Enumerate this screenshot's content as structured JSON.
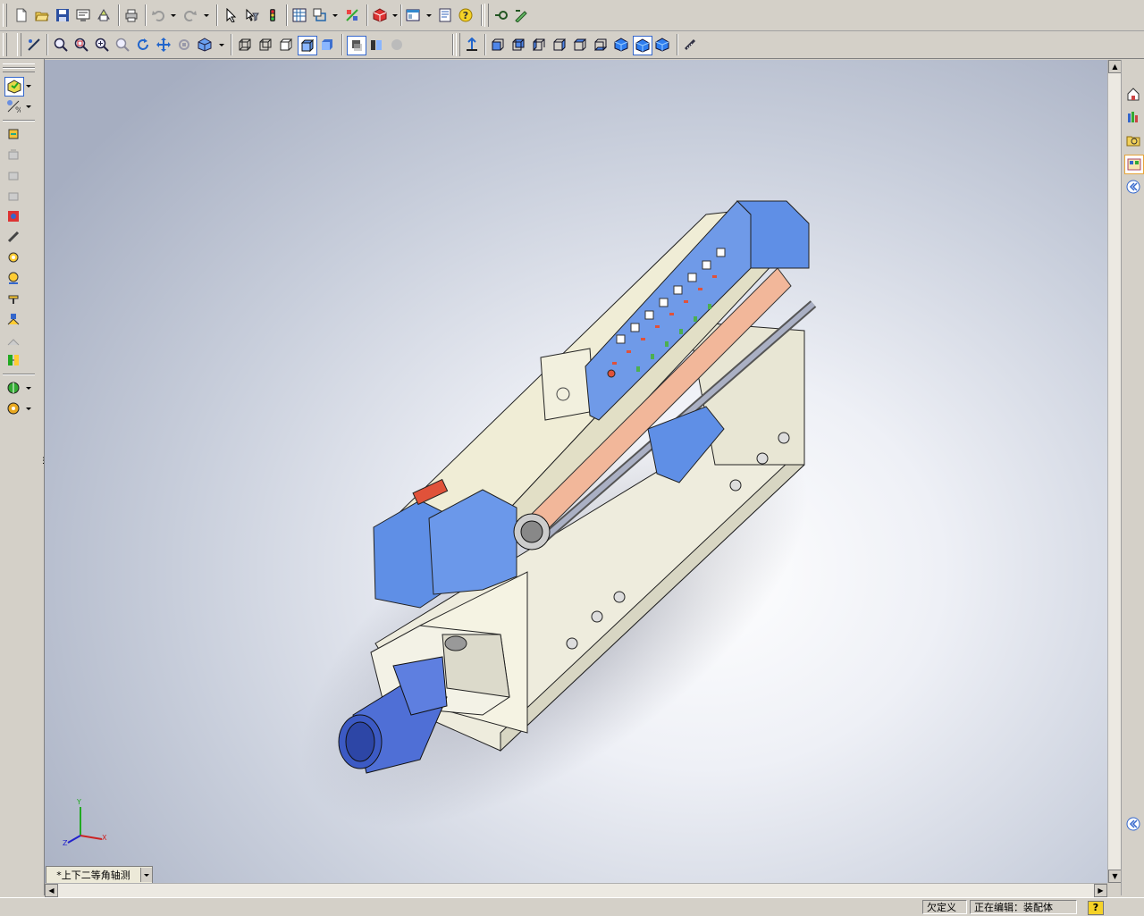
{
  "toolbar_top": {
    "buttons": [
      "new-document",
      "open",
      "save",
      "print-options",
      "make-drawing",
      "print",
      "undo",
      "redo",
      "select",
      "select-filter",
      "rebuild",
      "options-grid",
      "assembly-options",
      "edit-component",
      "color-appearance",
      "view-palette",
      "properties",
      "help",
      "macro-run",
      "macro-edit"
    ]
  },
  "toolbar_view": {
    "buttons": [
      "sketch-toggle",
      "zoom-to-fit",
      "zoom-area",
      "zoom-in-out",
      "zoom-selection",
      "rotate",
      "pan",
      "roll",
      "view-orientation",
      "front-view",
      "back-view",
      "left-view",
      "right-view",
      "top-view",
      "section-view",
      "hidden-lines",
      "shaded",
      "shadow",
      "normal-to",
      "isometric",
      "trimetric",
      "dimetric",
      "top-iso",
      "bottom-iso",
      "left-iso",
      "right-iso",
      "shaded-edges",
      "shaded-mode",
      "perspective",
      "measure"
    ]
  },
  "command_manager": {
    "items": [
      "insert-component",
      "mate",
      "new-part",
      "new-assembly",
      "hide-show",
      "component-pattern",
      "move-component",
      "rotate-component",
      "smart-fasteners",
      "explode-view",
      "explode-line",
      "interference-check",
      "assembly-features",
      "simulation"
    ]
  },
  "task_pane": {
    "items": [
      "home-icon",
      "design-library-icon",
      "file-explorer-icon",
      "view-palette-icon",
      "collapse-icon"
    ],
    "bottom_expand": "expand-icon"
  },
  "viewport": {
    "view_orientation": "*上下二等角轴测",
    "triad": {
      "x": "X",
      "y": "Y",
      "z": "Z"
    }
  },
  "status": {
    "underdefined": "欠定义",
    "editing": "正在编辑：装配体",
    "help": "?"
  },
  "colors": {
    "machine_blue": "#5f8fe6",
    "machine_cream": "#f1efd9",
    "red_accent": "#e0523a"
  }
}
